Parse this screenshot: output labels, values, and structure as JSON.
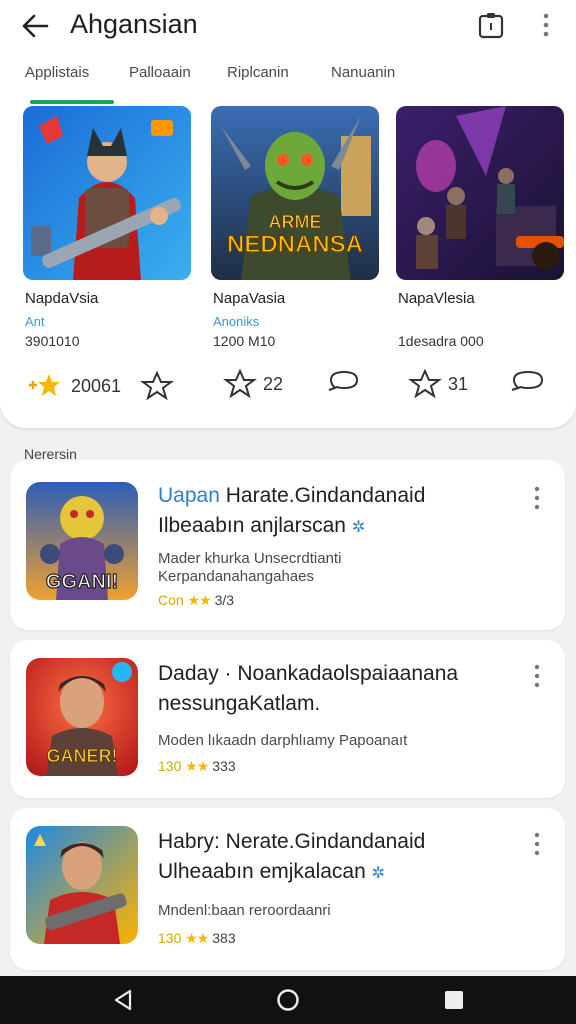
{
  "appbar": {
    "title": "Ahgansian",
    "back_icon": "back-arrow-icon",
    "clipboard_icon": "clipboard-icon",
    "more_icon": "more-vert-icon"
  },
  "tabs": [
    {
      "label": "Applistais",
      "selected": true
    },
    {
      "label": "Palloaain",
      "selected": false
    },
    {
      "label": "Riplcanin",
      "selected": false
    },
    {
      "label": "Nanuanin",
      "selected": false
    }
  ],
  "accent_color": "#1aa260",
  "featured": [
    {
      "name": "NapdaVsia",
      "category": "Ant",
      "downloads": "3901010",
      "art_text": ""
    },
    {
      "name": "NapaVasia",
      "category": "Anoniks",
      "downloads": "1200 M10",
      "art_text": "ARME NEDNANSA"
    },
    {
      "name": "NapaVlesia",
      "category": "",
      "downloads": "1desadra 000",
      "art_text": ""
    }
  ],
  "card_actions": [
    {
      "count": "20061"
    },
    {
      "count": "22"
    },
    {
      "count": "31"
    }
  ],
  "section": {
    "label": "Nerersin"
  },
  "list": [
    {
      "title_prefix": "Uapan",
      "title_rest": " Harate.Gindandanaid",
      "title_line2": "Ilbeaabın anjlarscan",
      "sub1": "Mader khurka Unsecrdtianti",
      "sub2": "Kerpandanahangahaes",
      "rating_lead": "Con",
      "stars": "★★",
      "rating": "3/3",
      "art_text": "GGANI!"
    },
    {
      "title_prefix": "",
      "title_rest": "Daday · Noankadaolspaiaanana",
      "title_line2": "nessungaKatlam.",
      "sub1": "Moden lıkaadn darphlıamy Papoanaıt",
      "sub2": "",
      "rating_lead": "130",
      "stars": "★★",
      "rating": "333",
      "art_text": "GANER!"
    },
    {
      "title_prefix": "",
      "title_rest": "Habry: Nerate.Gindandanaid",
      "title_line2": "Ulheaabın emjkalacan",
      "sub1": "Mndenl:baan reroordaanri",
      "sub2": "",
      "rating_lead": "130",
      "stars": "★★",
      "rating": "383",
      "art_text": ""
    }
  ],
  "navbar": {
    "back_icon": "triangle-back-icon",
    "home_icon": "circle-home-icon",
    "recents_icon": "square-recents-icon"
  }
}
